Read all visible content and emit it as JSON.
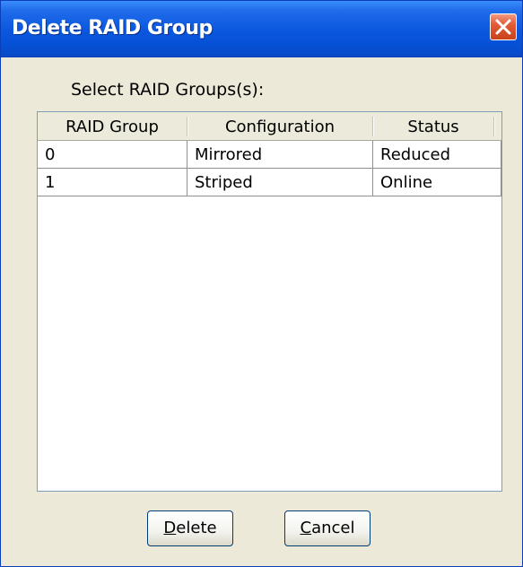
{
  "window": {
    "title": "Delete RAID Group"
  },
  "prompt": "Select RAID Groups(s):",
  "table": {
    "columns": [
      "RAID Group",
      "Configuration",
      "Status"
    ],
    "rows": [
      [
        "0",
        "Mirrored",
        "Reduced"
      ],
      [
        "1",
        "Striped",
        "Online"
      ]
    ]
  },
  "buttons": {
    "delete": {
      "mnemonic": "D",
      "rest": "elete"
    },
    "cancel": {
      "mnemonic": "C",
      "rest": "ancel"
    }
  },
  "icons": {
    "close": "close-icon"
  },
  "colors": {
    "titlebar": "#0a57de",
    "close": "#e25b36",
    "dialog_bg": "#ece9d8"
  }
}
